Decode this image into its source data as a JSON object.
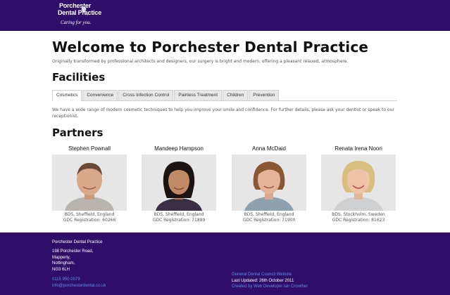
{
  "header": {
    "logo": {
      "line1": "Porchester",
      "line2": "Dental Practice",
      "tagline": "Caring for you."
    }
  },
  "main": {
    "title": "Welcome to Porchester Dental Practice",
    "intro": "Originally transformed by professional architects and designers, our surgery is bright and modern, offering a pleasant relaxed, atmosphere.",
    "facilities": {
      "heading": "Facilities",
      "tabs": [
        {
          "label": "Cosmetics",
          "active": true
        },
        {
          "label": "Convenience",
          "active": false
        },
        {
          "label": "Cross Infection Control",
          "active": false
        },
        {
          "label": "Painless Treatment",
          "active": false
        },
        {
          "label": "Children",
          "active": false
        },
        {
          "label": "Prevention",
          "active": false
        }
      ],
      "panel_text": "We have a wide range of modern cosmetic techniques to help you improve your smile and confidence. For further details, please ask your dentist or speak to our receptionist."
    },
    "partners": {
      "heading": "Partners",
      "list": [
        {
          "name": "Stephen Pownall",
          "quals": "BDS, Sheffield, England",
          "gdc": "GDC Registration: 60266"
        },
        {
          "name": "Mandeep Hampson",
          "quals": "BDS, Sheffield, England",
          "gdc": "GDC Registration: 71899"
        },
        {
          "name": "Anna McDaid",
          "quals": "BDS, Sheffield, England",
          "gdc": "GDC Registration: 71900"
        },
        {
          "name": "Renata Irena Noori",
          "quals": "BDS, Stockholm, Sweden",
          "gdc": "GDC Registration: 81623"
        }
      ]
    }
  },
  "footer": {
    "practice_name": "Porchester Dental Practice",
    "address": [
      "198 Porchester Road,",
      "Mapperly,",
      "Nottingham,",
      "NG3 6LH"
    ],
    "phone": "0115 950 0079",
    "email": "info@porchesterdental.co.uk",
    "gdc_link": "General Dental Council Website",
    "last_updated": "Last Updated: 26th October 2011",
    "credit": "Created by Web Developer Ian Crowther"
  },
  "colors": {
    "brand_purple": "#2f0e69",
    "link_blue": "#5b8fe0"
  }
}
